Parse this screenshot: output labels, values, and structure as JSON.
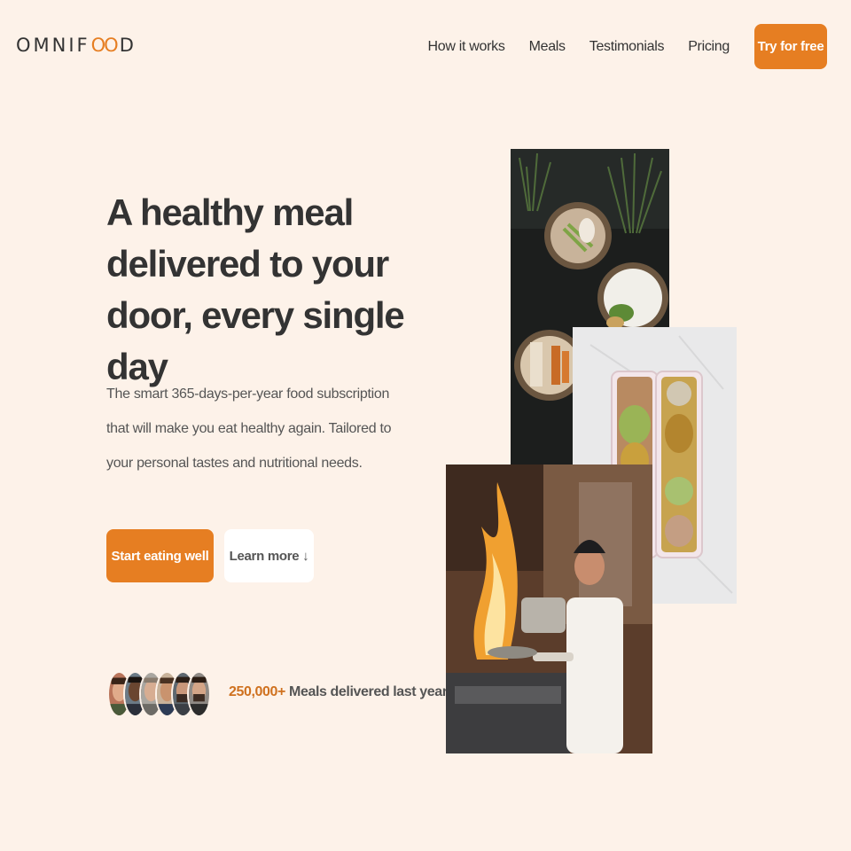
{
  "header": {
    "logo_pre": "OMNIF",
    "logo_oo": "OO",
    "logo_post": "D",
    "nav": [
      "How it works",
      "Meals",
      "Testimonials",
      "Pricing"
    ],
    "cta_label": "Try for free"
  },
  "hero": {
    "title": "A healthy meal delivered to your door, every single day",
    "description": "The smart 365-days-per-year food subscription that will make you eat healthy again. Tailored to your personal tastes and nutritional needs.",
    "primary_button": "Start eating well",
    "secondary_button": "Learn more ↓"
  },
  "delivered": {
    "number": "250,000+",
    "text": " Meals delivered last year!"
  },
  "colors": {
    "background": "#fdf2e9",
    "accent": "#e67e22",
    "text": "#333333"
  },
  "images": [
    "food-bowls-photo",
    "meal-boxes-photo",
    "chef-cooking-photo"
  ]
}
